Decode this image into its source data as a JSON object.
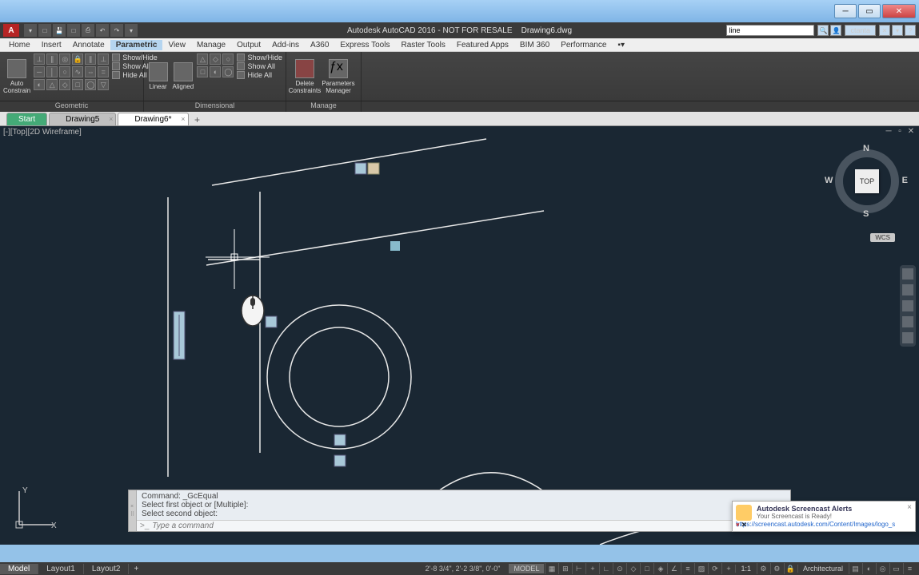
{
  "window": {
    "app_title": "Autodesk AutoCAD 2016 - NOT FOR RESALE",
    "doc_name": "Drawing6.dwg",
    "search_value": "line",
    "signin_label": "ctanta"
  },
  "menus": {
    "items": [
      "Home",
      "Insert",
      "Annotate",
      "Parametric",
      "View",
      "Manage",
      "Output",
      "Add-ins",
      "A360",
      "Express Tools",
      "Raster Tools",
      "Featured Apps",
      "BIM 360",
      "Performance"
    ],
    "active_index": 3
  },
  "ribbon": {
    "geometric": {
      "auto_label": "Auto\nConstrain",
      "show_hide": "Show/Hide",
      "show_all": "Show All",
      "hide_all": "Hide All",
      "panel_label": "Geometric"
    },
    "dimensional": {
      "linear": "Linear",
      "aligned": "Aligned",
      "show_hide": "Show/Hide",
      "show_all": "Show All",
      "hide_all": "Hide All",
      "panel_label": "Dimensional"
    },
    "manage": {
      "delete_label": "Delete\nConstraints",
      "params_label": "Parameters\nManager",
      "panel_label": "Manage"
    }
  },
  "doc_tabs": {
    "start": "Start",
    "tabs": [
      "Drawing5",
      "Drawing6*"
    ],
    "active_index": 1
  },
  "viewport": {
    "label": "[-][Top][2D Wireframe]",
    "viewcube": {
      "face": "TOP",
      "n": "N",
      "s": "S",
      "e": "E",
      "w": "W"
    },
    "wcs": "WCS"
  },
  "ucs": {
    "x": "X",
    "y": "Y"
  },
  "command": {
    "line1": "Command: _GcEqual",
    "line2": "Select first object or [Multiple]:",
    "line3": "Select second object:",
    "prompt": ">_",
    "placeholder": "Type a command"
  },
  "notification": {
    "title": "Autodesk Screencast Alerts",
    "body": "Your Screencast is Ready!",
    "link": "https://screencast.autodesk.com/Content/Images/logo_s"
  },
  "layout_tabs": {
    "items": [
      "Model",
      "Layout1",
      "Layout2"
    ],
    "active_index": 0
  },
  "status": {
    "coords": "2'-8 3/4\", 2'-2 3/8\", 0'-0\"",
    "model": "MODEL",
    "scale": "1:1",
    "units": "Architectural"
  }
}
